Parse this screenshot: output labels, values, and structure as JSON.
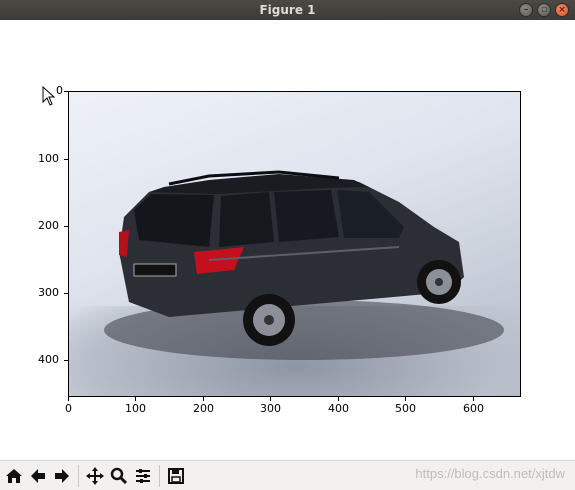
{
  "window": {
    "title": "Figure 1",
    "controls": [
      "minimize-icon",
      "maximize-icon",
      "close-icon"
    ]
  },
  "axes": {
    "image_description": "photo of a dark grey minivan",
    "y_ticks": [
      "0",
      "100",
      "200",
      "300",
      "400"
    ],
    "x_ticks": [
      "0",
      "100",
      "200",
      "300",
      "400",
      "500",
      "600"
    ],
    "xlim": [
      0,
      670
    ],
    "ylim": [
      455,
      0
    ]
  },
  "toolbar": {
    "tools": [
      "home-icon",
      "back-icon",
      "forward-icon",
      "pan-icon",
      "zoom-icon",
      "configure-icon",
      "save-icon"
    ]
  },
  "watermark": "https://blog.csdn.net/xjtdw"
}
